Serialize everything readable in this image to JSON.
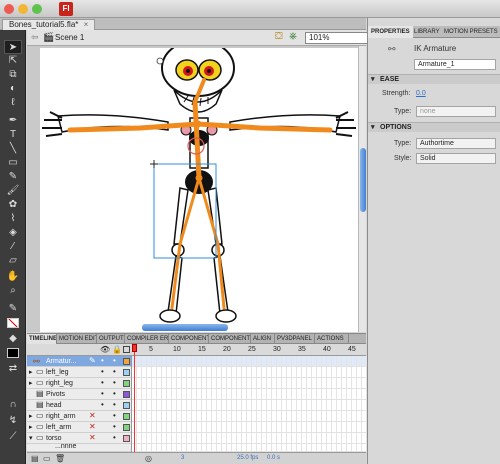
{
  "app": {
    "logo": "Fl",
    "document_tab": "Bones_tutorial5.fla*"
  },
  "editbar": {
    "scene": "Scene 1",
    "zoom": "101%"
  },
  "timeline": {
    "tabs": [
      "TIMELINE",
      "MOTION EDITO",
      "OUTPUT",
      "COMPILER ERR",
      "COMPONENT I",
      "COMPONENTS",
      "ALIGN",
      "PV3DPANEL",
      "ACTIONS"
    ],
    "frame_numbers": [
      "5",
      "10",
      "15",
      "20",
      "25",
      "30",
      "35",
      "40",
      "45"
    ],
    "layers": [
      {
        "name": "Armatur...",
        "selected": true,
        "color": "#f0a63c",
        "x": false
      },
      {
        "name": "left_leg",
        "selected": false,
        "color": "#9bd3f7",
        "x": false
      },
      {
        "name": "right_leg",
        "selected": false,
        "color": "#7fd67f",
        "x": false
      },
      {
        "name": "Pivots",
        "selected": false,
        "color": "#8a5bd6",
        "x": false
      },
      {
        "name": "head",
        "selected": false,
        "color": "#9bd3f7",
        "x": false
      },
      {
        "name": "right_arm",
        "selected": false,
        "color": "#7fd67f",
        "x": true
      },
      {
        "name": "left_arm",
        "selected": false,
        "color": "#7fd67f",
        "x": true
      },
      {
        "name": "torso",
        "selected": false,
        "color": "#f0b0c8",
        "x": true
      },
      {
        "name": "...nnne",
        "selected": false,
        "color": "#9bd3f7",
        "x": false
      }
    ],
    "footer": {
      "frame": "3",
      "fps": "25.0 fps",
      "time": "0.0 s"
    }
  },
  "panel": {
    "tabs": [
      "PROPERTIES",
      "LIBRARY",
      "MOTION PRESETS"
    ],
    "object_type": "IK Armature",
    "instance_name": "Armature_1",
    "ease": {
      "title": "EASE",
      "strength_label": "Strength:",
      "strength_value": "0.0",
      "type_label": "Type:",
      "type_value": "none"
    },
    "options": {
      "title": "OPTIONS",
      "type_label": "Type:",
      "type_value": "Authortime",
      "style_label": "Style:",
      "style_value": "Solid"
    }
  },
  "colors": {
    "bone": "#f08a1c",
    "selection": "#2f8fd8",
    "accent": "#3e7fd2"
  }
}
